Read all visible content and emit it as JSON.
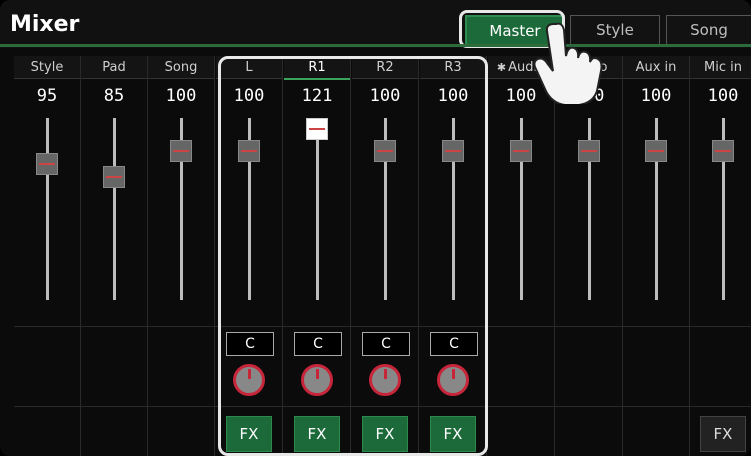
{
  "header": {
    "title": "Mixer",
    "tabs": [
      {
        "label": "Master",
        "active": true
      },
      {
        "label": "Style",
        "active": false
      },
      {
        "label": "Song",
        "active": false
      }
    ]
  },
  "channels": [
    {
      "label": "Style",
      "value": "95",
      "level": 0.78
    },
    {
      "label": "Pad",
      "value": "85",
      "level": 0.7
    },
    {
      "label": "Song",
      "value": "100",
      "level": 0.86
    },
    {
      "label": "L",
      "value": "100",
      "level": 0.86,
      "pan": "C",
      "fx": "FX"
    },
    {
      "label": "R1",
      "value": "121",
      "level": 1.0,
      "pan": "C",
      "fx": "FX",
      "active": true
    },
    {
      "label": "R2",
      "value": "100",
      "level": 0.86,
      "pan": "C",
      "fx": "FX"
    },
    {
      "label": "R3",
      "value": "100",
      "level": 0.86,
      "pan": "C",
      "fx": "FX"
    },
    {
      "label": "Audio",
      "value": "100",
      "level": 0.86,
      "bluetooth": true
    },
    {
      "label": "Audio",
      "value": "100",
      "level": 0.86
    },
    {
      "label": "Aux in",
      "value": "100",
      "level": 0.86
    },
    {
      "label": "Mic in",
      "value": "100",
      "level": 0.86,
      "fx": "FX",
      "fx_dim": true
    }
  ],
  "colors": {
    "accent": "#1c6a3a",
    "dial": "#c7263a"
  }
}
